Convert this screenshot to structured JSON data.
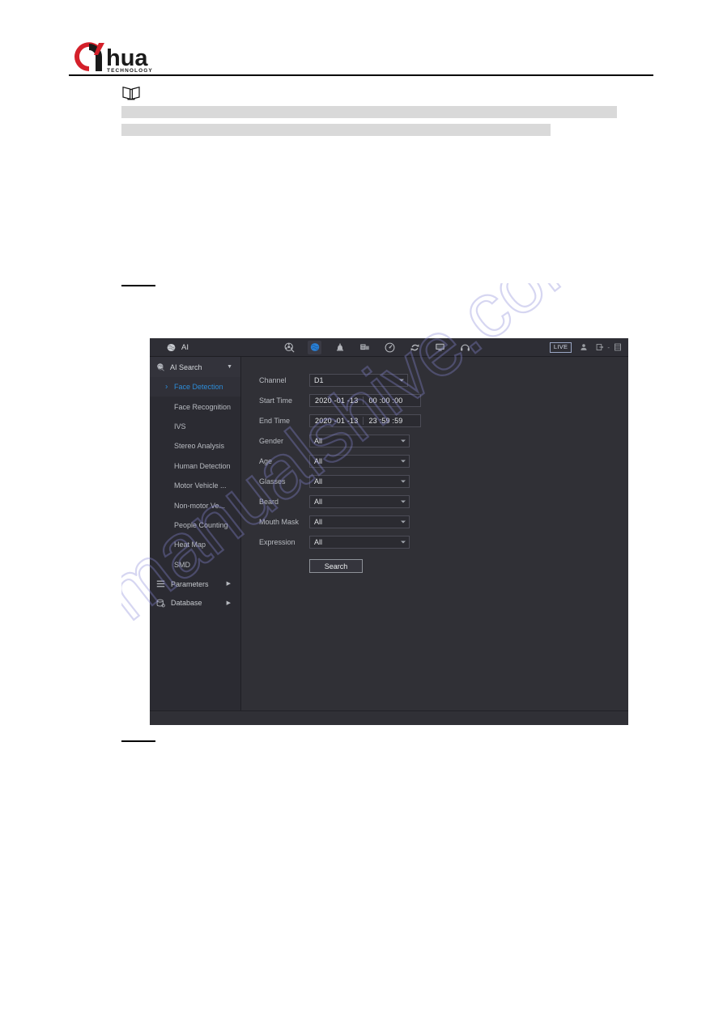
{
  "document": {
    "brand": "alhua",
    "brand_sub": "TECHNOLOGY"
  },
  "notice": {
    "icon": "book-note-icon"
  },
  "nvr": {
    "titlebar": {
      "title": "AI",
      "title_icon": "ai-brain-icon",
      "nav_icons": [
        {
          "name": "search-playback-icon",
          "active": false
        },
        {
          "name": "ai-brain-icon",
          "active": true
        },
        {
          "name": "alarm-bell-icon",
          "active": false
        },
        {
          "name": "backup-icon",
          "active": false
        },
        {
          "name": "dashboard-gauge-icon",
          "active": false
        },
        {
          "name": "maintenance-refresh-icon",
          "active": false
        },
        {
          "name": "display-monitor-icon",
          "active": false
        },
        {
          "name": "audio-headset-icon",
          "active": false
        }
      ],
      "live_label": "LIVE",
      "right_icons": [
        {
          "name": "user-account-icon"
        },
        {
          "name": "logout-icon"
        },
        {
          "name": "shutdown-menu-icon"
        }
      ],
      "right_separator": "-"
    },
    "sidebar": {
      "group_label": "AI Search",
      "group_icon": "ai-search-icon",
      "items": [
        {
          "label": "Face Detection",
          "selected": true
        },
        {
          "label": "Face Recognition",
          "selected": false
        },
        {
          "label": "IVS",
          "selected": false
        },
        {
          "label": "Stereo Analysis",
          "selected": false
        },
        {
          "label": "Human Detection",
          "selected": false
        },
        {
          "label": "Motor Vehicle ...",
          "selected": false
        },
        {
          "label": "Non-motor Ve...",
          "selected": false
        },
        {
          "label": "People Counting",
          "selected": false
        },
        {
          "label": "Heat Map",
          "selected": false
        },
        {
          "label": "SMD",
          "selected": false
        }
      ],
      "footer_items": [
        {
          "label": "Parameters",
          "icon": "list-parameters-icon"
        },
        {
          "label": "Database",
          "icon": "database-icon"
        }
      ]
    },
    "form": {
      "channel": {
        "label": "Channel",
        "value": "D1"
      },
      "start_time": {
        "label": "Start Time",
        "date": "2020 -01 -13",
        "time": "00 :00 :00"
      },
      "end_time": {
        "label": "End Time",
        "date": "2020 -01 -13",
        "time": "23 :59 :59"
      },
      "attributes": [
        {
          "label": "Gender",
          "value": "All"
        },
        {
          "label": "Age",
          "value": "All"
        },
        {
          "label": "Glasses",
          "value": "All"
        },
        {
          "label": "Beard",
          "value": "All"
        },
        {
          "label": "Mouth Mask",
          "value": "All"
        },
        {
          "label": "Expression",
          "value": "All"
        }
      ],
      "search_button": "Search"
    }
  },
  "watermark": {
    "text": "manualshive.com"
  }
}
